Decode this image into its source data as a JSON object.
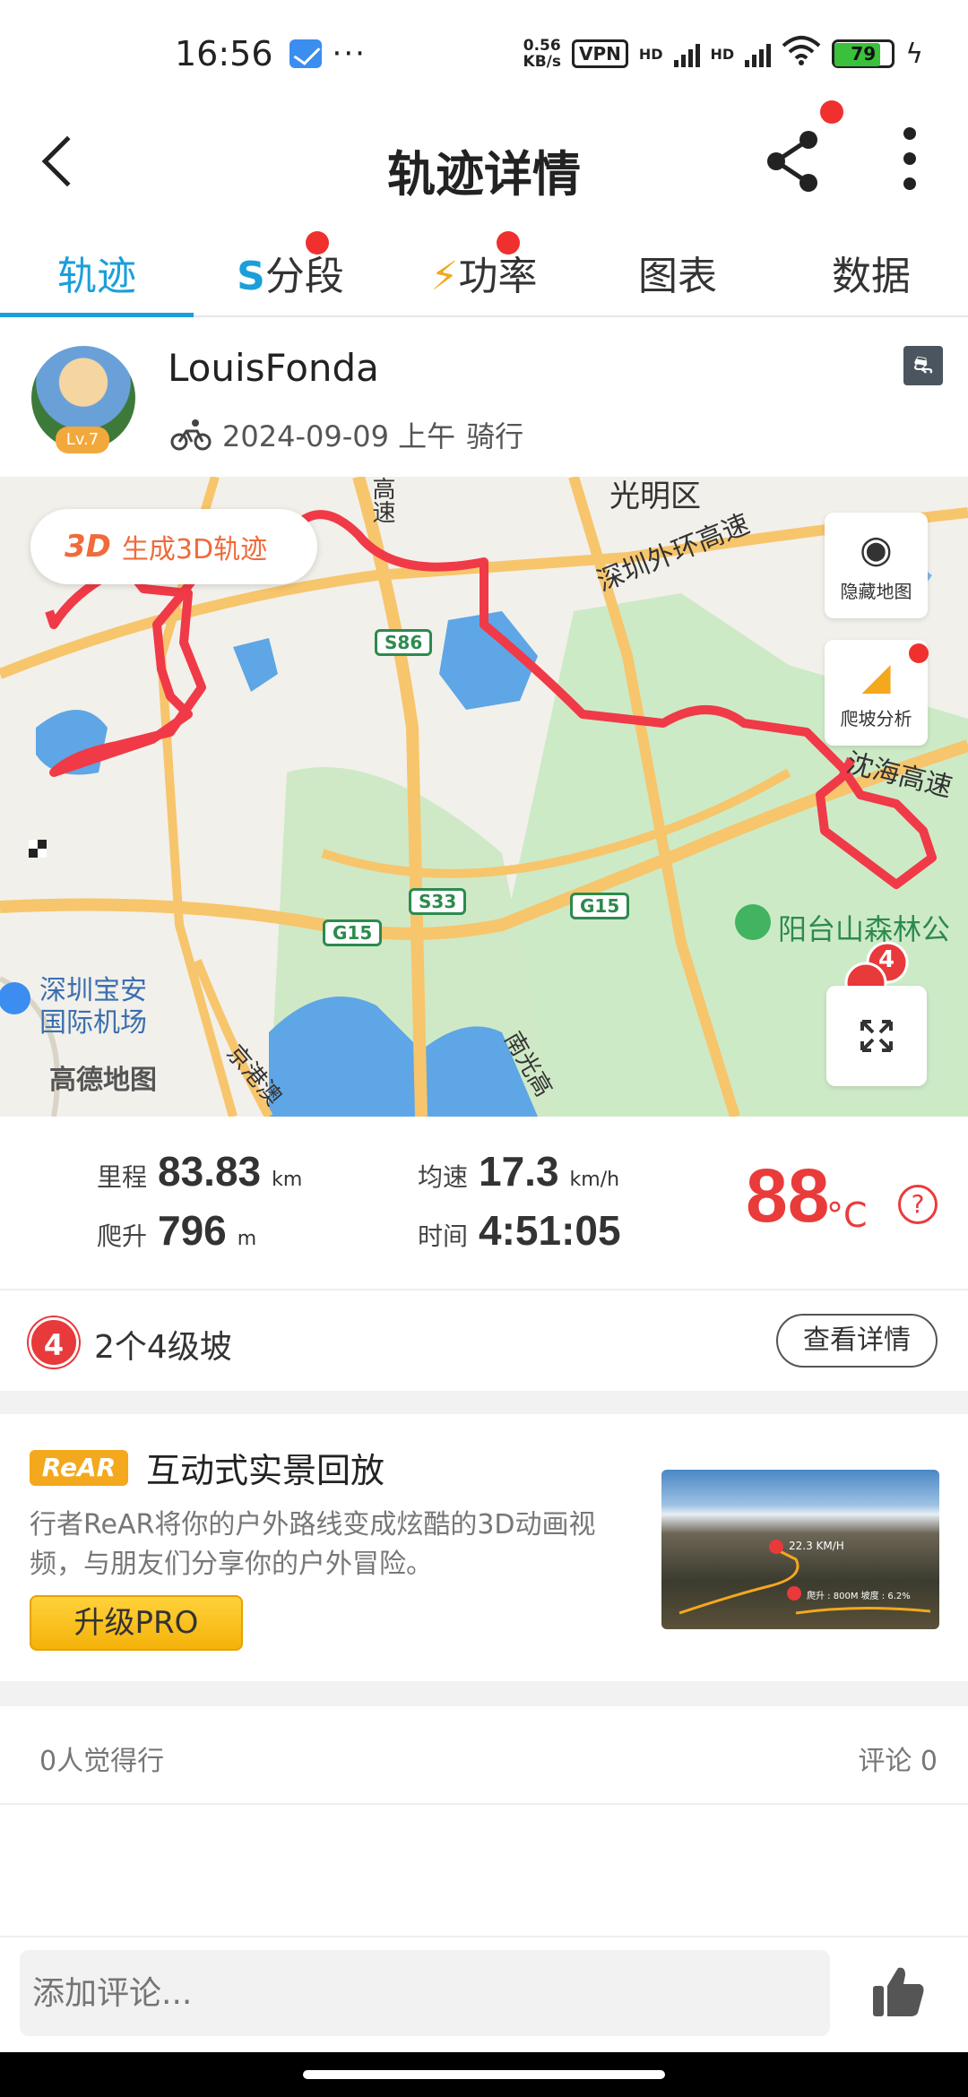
{
  "status_bar": {
    "time": "16:56",
    "net_speed_value": "0.56",
    "net_speed_unit": "KB/s",
    "vpn": "VPN",
    "sig1": "HD",
    "sig2": "HD",
    "battery": "79"
  },
  "header": {
    "title": "轨迹详情"
  },
  "tabs": [
    {
      "label": "轨迹",
      "active": true
    },
    {
      "icon": "S",
      "label": "分段",
      "badge": true
    },
    {
      "icon": "⚡",
      "label": "功率",
      "badge": true
    },
    {
      "label": "图表"
    },
    {
      "label": "数据"
    }
  ],
  "user": {
    "name": "LouisFonda",
    "level": "Lv.7",
    "date": "2024-09-09 上午",
    "activity": "骑行"
  },
  "map": {
    "btn3d_icon": "3D",
    "btn3d_label": "生成3D轨迹",
    "hide_map": "隐藏地图",
    "climb_analysis": "爬坡分析",
    "labels": {
      "guangming": "光明区",
      "gaosu": "高速",
      "waihuan": "深圳外环高速",
      "shenhai": "沈海高速",
      "forest": "阳台山森林公",
      "airport1": "深圳宝安",
      "airport2": "国际机场",
      "jinggangao": "京港澳",
      "nanguang": "南光高",
      "s86": "S86",
      "s33": "S33",
      "g15a": "G15",
      "g15b": "G15",
      "climb_marker": "4"
    },
    "logo": "高德地图",
    "colors": {
      "route": "#f03a47",
      "road": "#f7c56b",
      "water": "#5ea6e6",
      "green": "#bfe6c4"
    }
  },
  "stats": {
    "distance_label": "里程",
    "distance": "83.83",
    "distance_unit": "km",
    "climb_label": "爬升",
    "climb": "796",
    "climb_unit": "m",
    "avg_label": "均速",
    "avg_speed": "17.3",
    "avg_unit": "km/h",
    "time_label": "时间",
    "time": "4:51:05",
    "temperature": "88",
    "temp_unit": "°C",
    "help": "?"
  },
  "climb": {
    "level": "4",
    "text": "2个4级坡",
    "detail_button": "查看详情"
  },
  "promo": {
    "tag": "ReAR",
    "title": "互动式实景回放",
    "desc": "行者ReAR将你的户外路线变成炫酷的3D动画视频，与朋友们分享你的户外冒险。",
    "button": "升级PRO",
    "img_speed": "22.3 KM/H",
    "img_stats": "爬升 : 800M 坡度 : 6.2%"
  },
  "social": {
    "likes": "0人觉得行",
    "comments": "评论 0"
  },
  "comment_input": {
    "placeholder": "添加评论..."
  }
}
